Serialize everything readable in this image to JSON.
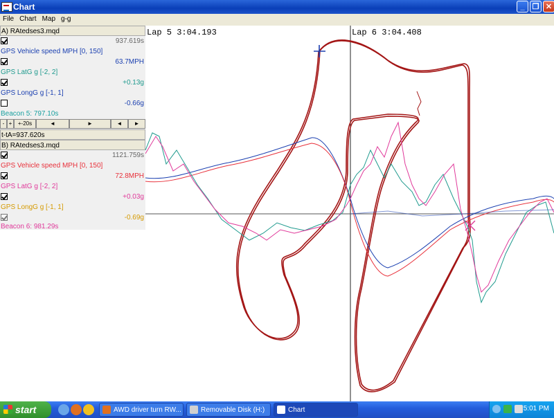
{
  "window": {
    "title": "Chart",
    "minimize": "_",
    "maximize": "❐",
    "close": "✕"
  },
  "menu": [
    "File",
    "Chart",
    "Map",
    "g-g"
  ],
  "panelA": {
    "file": "A) RAtedses3.mqd",
    "time": "937.619s",
    "speed_label": "GPS Vehicle speed MPH [0, 150]",
    "speed_value": "63.7MPH",
    "latg_label": "GPS LatG g [-2, 2]",
    "latg_value": "+0.13g",
    "longg_label": "GPS LongG g [-1, 1]",
    "longg_value": "-0.66g",
    "beacon": "Beacon 5:   797.10s",
    "nav_labels": [
      "-",
      "+",
      "+-20s",
      "◄",
      "►",
      "◄",
      "►"
    ],
    "delta": "t-tA=937.620s"
  },
  "panelB": {
    "file": "B) RAtedses3.mqd",
    "time": "1121.759s",
    "speed_label": "GPS Vehicle speed MPH [0, 150]",
    "speed_value": "72.8MPH",
    "latg_label": "GPS LatG g [-2, 2]",
    "latg_value": "+0.03g",
    "longg_label": "GPS LongG g [-1, 1]",
    "longg_value": "-0.69g",
    "beacon": "Beacon 6:   981.29s"
  },
  "laps": {
    "lap5": "Lap   5 3:04.193",
    "lap6": "Lap   6 3:04.408"
  },
  "colors": {
    "track": "#a31515",
    "speedA": "#1a3fb0",
    "latA": "#1f9a8e",
    "longA": "#1a3fb0",
    "speedB": "#e8303a",
    "latB": "#e0399a",
    "longB": "#d59a00",
    "beaconA": "#1aa0a0",
    "beaconB": "#e0399a"
  },
  "taskbar": {
    "start": "start",
    "tasks": [
      "AWD driver turn RW...",
      "Removable Disk (H:)",
      "Chart"
    ],
    "clock": "5:01 PM"
  }
}
